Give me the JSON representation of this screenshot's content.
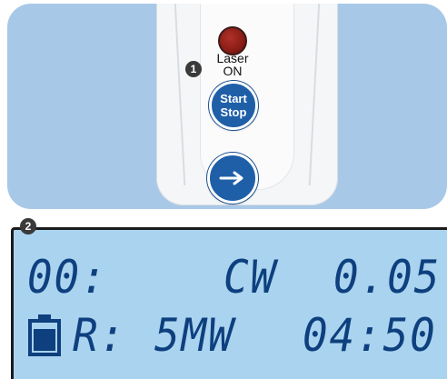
{
  "device": {
    "laser_led": {
      "label_line1": "Laser",
      "label_line2": "ON",
      "color": "#8a1c16"
    },
    "start_stop_button": {
      "line1": "Start",
      "line2": "Stop"
    },
    "next_button": {
      "icon": "arrow-right-icon"
    },
    "callout": "1",
    "colors": {
      "panel": "#a8c8e8",
      "button": "#1f5fa8"
    }
  },
  "lcd": {
    "callout": "2",
    "row1": {
      "channel": "00:",
      "mode": "CW",
      "value": "0.05"
    },
    "row2": {
      "battery_icon": "battery-icon",
      "label": "R:",
      "power": "5MW",
      "time": "04:50"
    },
    "colors": {
      "background": "#a9d3ef",
      "segments": "#0e3f7e"
    }
  }
}
